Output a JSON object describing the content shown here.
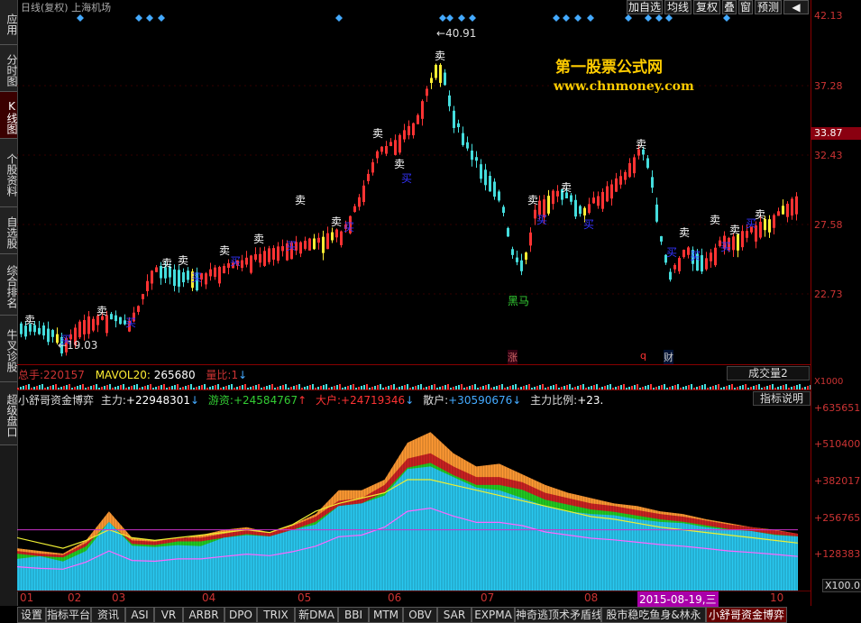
{
  "sidebar": {
    "tabs": [
      {
        "label": "应用"
      },
      {
        "label": "分时图"
      },
      {
        "label": "K线图"
      },
      {
        "label": "个股资料"
      },
      {
        "label": "自选股"
      },
      {
        "label": "综合排名"
      },
      {
        "label": "牛叉诊股"
      },
      {
        "label": "超级盘口"
      }
    ]
  },
  "header": {
    "title": "日线(复权) 上海机场",
    "buttons": [
      "加自选",
      "均线",
      "复权",
      "叠",
      "窗",
      "预测"
    ],
    "arrow_left": "◀",
    "arrow_right": "▶"
  },
  "watermark": {
    "line1": "第一股票公式网",
    "line2": "www.chnmoney.com"
  },
  "price_axis": {
    "labels": [
      "42.13",
      "37.28",
      "32.43",
      "27.58",
      "22.73"
    ],
    "current_price": "33.87"
  },
  "annotations": {
    "high": "40.91",
    "low": "19.03",
    "heima": "黑马",
    "buy": "买",
    "sell": "卖",
    "zhang": "涨",
    "q": "q",
    "cai": "财"
  },
  "volume_info": {
    "zongshou_label": "总手:",
    "zongshou_value": "220157",
    "mavol_label": "MAVOL20:",
    "mavol_value": "265680",
    "liangbi_label": "量比:",
    "liangbi_value": "1",
    "dropdown_label": "成交量2",
    "axis_label": "X1000"
  },
  "indicator": {
    "name": "小舒哥资金博弈",
    "zhuli_label": "主力:",
    "zhuli_value": "+22948301",
    "youzi_label": "游资:",
    "youzi_value": "+24584767",
    "dahu_label": "大户:",
    "dahu_value": "+24719346",
    "sanhu_label": "散户:",
    "sanhu_value": "+30590676",
    "ratio_label": "主力比例:",
    "ratio_value": "+23.",
    "help_button": "指标说明",
    "axis_labels": [
      "+635651",
      "+510400",
      "+382017",
      "+256765",
      "+128383"
    ],
    "axis_unit": "X100.0"
  },
  "months": [
    "01",
    "02",
    "03",
    "04",
    "05",
    "06",
    "07",
    "08",
    "10"
  ],
  "date_highlight": "2015-08-19,三",
  "bottom_tabs": [
    "设置",
    "指标平台",
    "资讯",
    "ASI",
    "VR",
    "ARBR",
    "DPO",
    "TRIX",
    "新DMA",
    "BBI",
    "MTM",
    "OBV",
    "SAR",
    "EXPMA",
    "神奇逃顶术矛盾线",
    "股市稳吃鱼身&林永",
    "小舒哥资金博弈"
  ],
  "colors": {
    "up": "#ff3333",
    "down": "#44dddd",
    "yellow": "#ffee33",
    "axis": "#cc3333",
    "watermark": "#ffcc00"
  },
  "chart_data": {
    "type": "area",
    "title": "小舒哥资金博弈",
    "series": [
      {
        "name": "主力",
        "values": [
          120000,
          130000,
          110000,
          150000,
          260000,
          170000,
          165000,
          172000,
          168000,
          200000,
          210000,
          205000,
          230000,
          250000,
          320000,
          330000,
          360000,
          460000,
          470000,
          430000,
          390000,
          380000,
          350000,
          320000,
          300000,
          290000,
          285000,
          270000,
          260000,
          255000,
          240000,
          230000,
          225000,
          210000,
          205000
        ]
      },
      {
        "name": "游资",
        "values": [
          160000,
          150000,
          140000,
          190000,
          300000,
          200000,
          190000,
          195000,
          210000,
          230000,
          240000,
          220000,
          250000,
          290000,
          380000,
          380000,
          420000,
          560000,
          600000,
          520000,
          470000,
          480000,
          440000,
          400000,
          370000,
          350000,
          330000,
          320000,
          300000,
          290000,
          270000,
          255000,
          240000,
          230000,
          215000
        ]
      },
      {
        "name": "大户",
        "values": [
          150000,
          140000,
          135000,
          180000,
          250000,
          190000,
          185000,
          200000,
          200000,
          215000,
          230000,
          220000,
          245000,
          280000,
          340000,
          350000,
          400000,
          500000,
          520000,
          470000,
          430000,
          430000,
          410000,
          370000,
          350000,
          330000,
          320000,
          305000,
          290000,
          280000,
          265000,
          250000,
          240000,
          228000,
          215000
        ]
      },
      {
        "name": "散户",
        "values": [
          200000,
          180000,
          160000,
          190000,
          230000,
          200000,
          190000,
          200000,
          210000,
          220000,
          230000,
          220000,
          250000,
          300000,
          330000,
          350000,
          370000,
          420000,
          420000,
          400000,
          380000,
          360000,
          340000,
          320000,
          300000,
          280000,
          270000,
          255000,
          240000,
          230000,
          220000,
          210000,
          200000,
          190000,
          180000
        ]
      }
    ],
    "ylim": [
      0,
      700000
    ]
  }
}
